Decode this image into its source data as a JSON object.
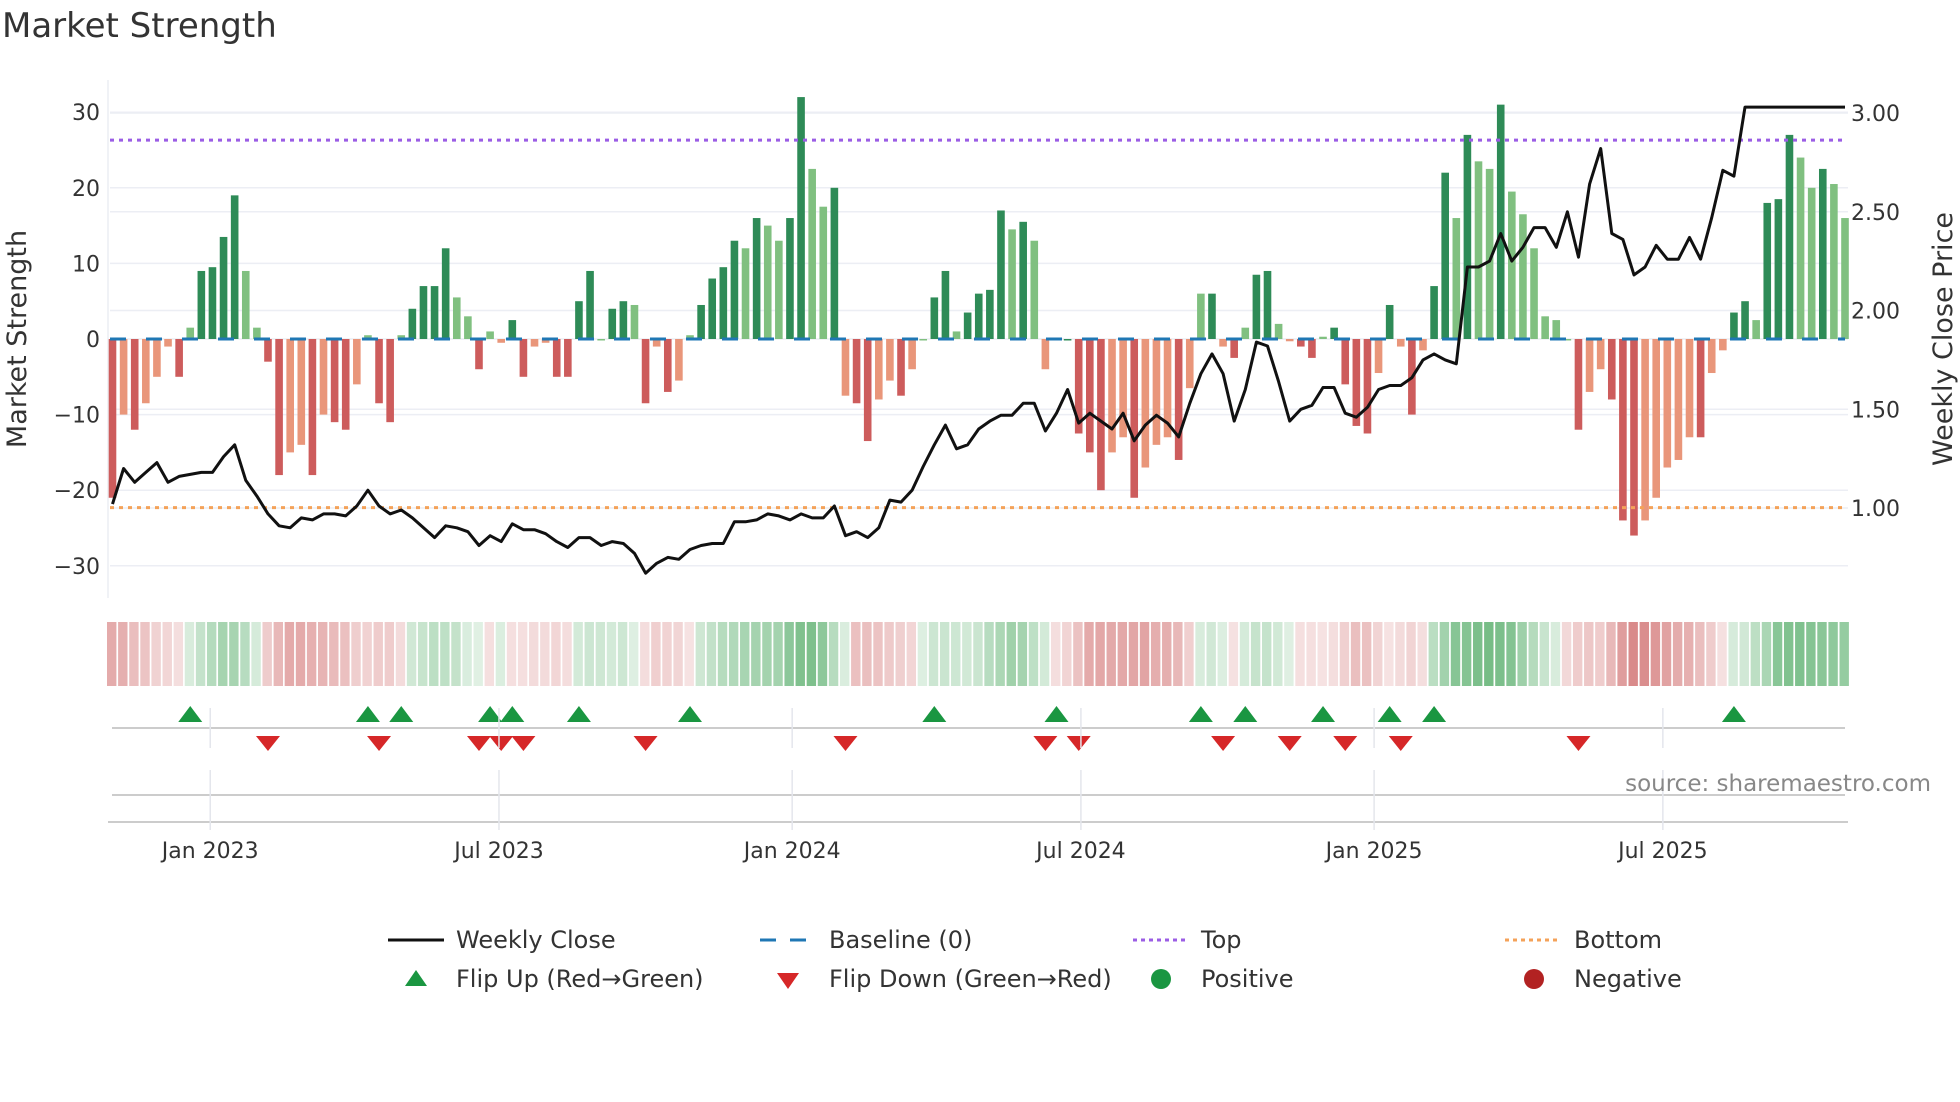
{
  "title": "Market Strength",
  "source": "source: sharemaestro.com",
  "legend": {
    "weekly_close": "Weekly Close",
    "baseline": "Baseline (0)",
    "top": "Top",
    "bottom": "Bottom",
    "flip_up": "Flip Up (Red→Green)",
    "flip_down": "Flip Down (Green→Red)",
    "positive": "Positive",
    "negative": "Negative"
  },
  "colors": {
    "pos_dark": "#2e8b57",
    "pos_light": "#80c080",
    "neg_dark": "#cd5c5c",
    "neg_light": "#e9967a",
    "close": "#111111",
    "baseline": "#1f77b4",
    "top": "#9b5de5",
    "bottom": "#f4a259",
    "flip_up": "#1a9641",
    "flip_down": "#d62728",
    "positive": "#1a9641",
    "negative": "#b22222",
    "grid": "#eceef4"
  },
  "chart_data": {
    "type": "bar+line",
    "title": "Market Strength",
    "ylabel": "Market Strength",
    "y2label": "Weekly Close Price",
    "ylim": [
      -35,
      34
    ],
    "y2lim": [
      0.62,
      3.2
    ],
    "yticks": [
      30,
      20,
      10,
      0,
      -10,
      -20,
      -30
    ],
    "ytick_labels": [
      "30",
      "20",
      "10",
      "0",
      "−10",
      "−20",
      "−30"
    ],
    "y2ticks": [
      3.0,
      2.5,
      2.0,
      1.5,
      1.0
    ],
    "y2tick_labels": [
      "3.00",
      "2.50",
      "2.00",
      "1.50",
      "1.00"
    ],
    "xticks": [
      {
        "label": "Jan 2023",
        "week": 8.8
      },
      {
        "label": "Jul 2023",
        "week": 34.8
      },
      {
        "label": "Jan 2024",
        "week": 61.2
      },
      {
        "label": "Jul 2024",
        "week": 87.2
      },
      {
        "label": "Jan 2025",
        "week": 113.6
      },
      {
        "label": "Jul 2025",
        "week": 139.6
      }
    ],
    "top_level": 26.3,
    "bottom_level": -22.3,
    "strength": [
      -21,
      -10,
      -12,
      -8.5,
      -5,
      -1,
      -5,
      1.5,
      9,
      9.5,
      13.5,
      19,
      9,
      1.5,
      -3,
      -18,
      -15,
      -14,
      -18,
      -10,
      -11,
      -12,
      -6,
      0.5,
      -8.5,
      -11,
      0.5,
      4,
      7,
      7,
      12,
      5.5,
      3,
      -4,
      1,
      -0.5,
      2.5,
      -5,
      -1,
      -0.5,
      -5,
      -5,
      5,
      9,
      0,
      4,
      5,
      4.5,
      -8.5,
      -1,
      -7,
      -5.5,
      0.5,
      4.5,
      8,
      9.5,
      13,
      12,
      16,
      15,
      13,
      16,
      32,
      22.5,
      17.5,
      20,
      -7.5,
      -8.5,
      -13.5,
      -8,
      -5.5,
      -7.5,
      -4,
      0,
      5.5,
      9,
      1,
      3.5,
      6,
      6.5,
      17,
      14.5,
      15.5,
      13,
      -4,
      0,
      0,
      -12.5,
      -15,
      -20,
      -15,
      -13,
      -21,
      -17,
      -14,
      -13,
      -16,
      -6.5,
      6,
      6,
      -1,
      -2.5,
      1.5,
      8.5,
      9,
      2,
      -0.3,
      -1,
      -2.5,
      0.3,
      1.5,
      -6,
      -11.5,
      -12.5,
      -4.5,
      4.5,
      -1,
      -10,
      -1.5,
      7,
      22,
      16,
      27,
      23.5,
      22.5,
      31,
      19.5,
      16.5,
      12,
      3,
      2.5,
      0,
      -12,
      -7,
      -4,
      -8,
      -24,
      -26,
      -24,
      -21,
      -17,
      -16,
      -13,
      -13,
      -4.5,
      -1.5,
      3.5,
      5,
      2.5,
      18,
      18.5,
      27,
      24,
      20,
      22.5,
      20.5,
      16
    ],
    "weekly_close": [
      1.02,
      1.2,
      1.13,
      1.18,
      1.23,
      1.13,
      1.16,
      1.17,
      1.18,
      1.18,
      1.26,
      1.32,
      1.14,
      1.06,
      0.97,
      0.91,
      0.9,
      0.95,
      0.94,
      0.97,
      0.97,
      0.96,
      1.01,
      1.09,
      1.01,
      0.97,
      0.99,
      0.95,
      0.9,
      0.85,
      0.91,
      0.9,
      0.88,
      0.81,
      0.86,
      0.83,
      0.92,
      0.89,
      0.89,
      0.87,
      0.83,
      0.8,
      0.85,
      0.85,
      0.81,
      0.83,
      0.82,
      0.77,
      0.67,
      0.72,
      0.75,
      0.74,
      0.79,
      0.81,
      0.82,
      0.82,
      0.93,
      0.93,
      0.94,
      0.97,
      0.96,
      0.94,
      0.97,
      0.95,
      0.95,
      1.01,
      0.86,
      0.88,
      0.85,
      0.9,
      1.04,
      1.03,
      1.09,
      1.21,
      1.32,
      1.42,
      1.3,
      1.32,
      1.4,
      1.44,
      1.47,
      1.47,
      1.53,
      1.53,
      1.39,
      1.48,
      1.6,
      1.43,
      1.48,
      1.44,
      1.4,
      1.48,
      1.34,
      1.42,
      1.47,
      1.43,
      1.36,
      1.53,
      1.68,
      1.78,
      1.68,
      1.44,
      1.6,
      1.84,
      1.82,
      1.64,
      1.44,
      1.5,
      1.52,
      1.61,
      1.61,
      1.48,
      1.46,
      1.51,
      1.6,
      1.62,
      1.62,
      1.66,
      1.75,
      1.78,
      1.75,
      1.73,
      2.22,
      2.22,
      2.25,
      2.39,
      2.25,
      2.32,
      2.42,
      2.42,
      2.32,
      2.5,
      2.27,
      2.64,
      2.82,
      2.39,
      2.36,
      2.18,
      2.22,
      2.33,
      2.26,
      2.26,
      2.37,
      2.26,
      2.47,
      2.71,
      2.68,
      3.03,
      3.03,
      3.03,
      3.03,
      3.03,
      3.03,
      3.03,
      3.03,
      3.03,
      3.03
    ],
    "flip_up_weeks": [
      7,
      23,
      26,
      34,
      36,
      42,
      52,
      74,
      85,
      98,
      102,
      109,
      115,
      119,
      146
    ],
    "flip_down_weeks": [
      14,
      24,
      33,
      35,
      37,
      48,
      66,
      84,
      87,
      100,
      106,
      111,
      116,
      132
    ],
    "grid": true,
    "legend_position": "bottom"
  }
}
